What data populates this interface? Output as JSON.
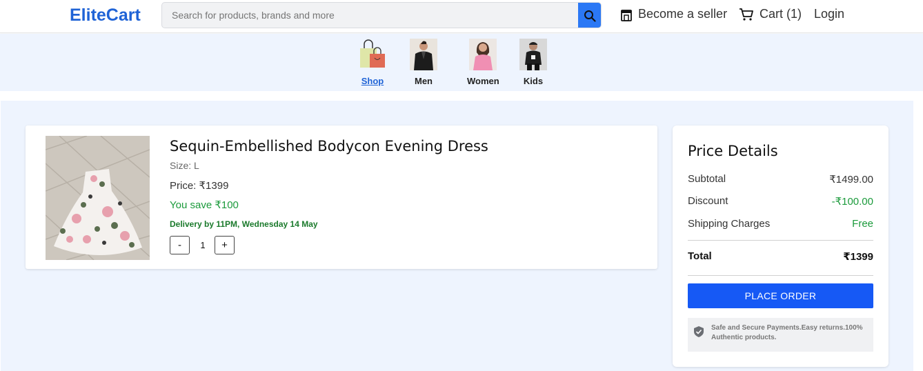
{
  "header": {
    "logo": "EliteCart",
    "search": {
      "placeholder": "Search for products, brands and more"
    },
    "become_seller": "Become a seller",
    "cart": "Cart (1)",
    "login": "Login"
  },
  "categories": [
    {
      "label": "Shop",
      "active": true
    },
    {
      "label": "Men",
      "active": false
    },
    {
      "label": "Women",
      "active": false
    },
    {
      "label": "Kids",
      "active": false
    }
  ],
  "cart_item": {
    "title": "Sequin-Embellished Bodycon Evening Dress",
    "size": "Size: L",
    "price": "Price: ₹1399",
    "savings": "You save ₹100",
    "delivery": "Delivery by 11PM, Wednesday 14 May",
    "qty_minus": "-",
    "quantity": "1",
    "qty_plus": "+"
  },
  "price_details": {
    "title": "Price Details",
    "subtotal_label": "Subtotal",
    "subtotal_value": "₹1499.00",
    "discount_label": "Discount",
    "discount_value": "-₹100.00",
    "shipping_label": "Shipping Charges",
    "shipping_value": "Free",
    "total_label": "Total",
    "total_value": "₹1399",
    "place_order": "PLACE ORDER",
    "secure_note": "Safe and Secure Payments.Easy returns.100% Authentic products."
  },
  "colors": {
    "brand": "#1f63d6",
    "button": "#1659f5",
    "positive": "#1b9a3b",
    "background": "#eef4fe"
  }
}
